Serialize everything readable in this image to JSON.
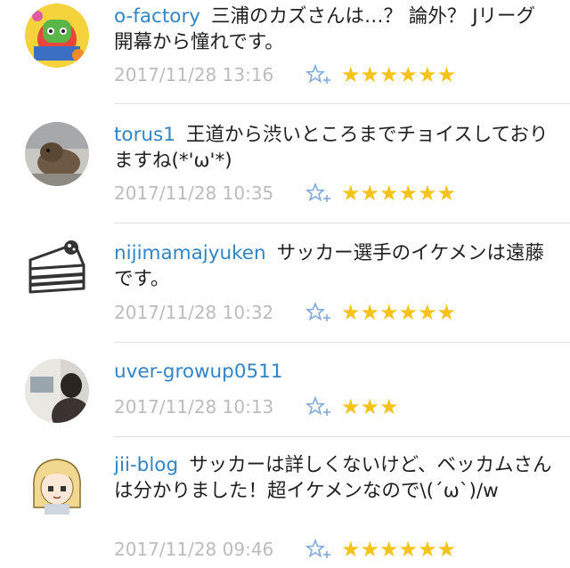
{
  "comments": [
    {
      "username": "o-factory",
      "text": "三浦のカズさんは…？ 論外？ Jリーグ開幕から憧れです。",
      "date": "2017/11/28 13:16",
      "stars": "★★★★★★",
      "star_count": 6,
      "avatar_icon": "cartoon-character-avatar-icon"
    },
    {
      "username": "torus1",
      "text": "王道から渋いところまでチョイスしておりますね(*'ω'*)",
      "date": "2017/11/28 10:35",
      "stars": "★★★★★★",
      "star_count": 6,
      "avatar_icon": "animal-photo-avatar-icon"
    },
    {
      "username": "nijimamajyuken",
      "text": "サッカー選手のイケメンは遠藤です。",
      "date": "2017/11/28 10:32",
      "stars": "★★★★★★",
      "star_count": 6,
      "avatar_icon": "cake-slice-avatar-icon"
    },
    {
      "username": "uver-growup0511",
      "text": "",
      "date": "2017/11/28 10:13",
      "stars": "★★★",
      "star_count": 3,
      "avatar_icon": "person-photo-avatar-icon"
    },
    {
      "username": "jii-blog",
      "text": "サッカーは詳しくないけど、ベッカムさんは分かりました！超イケメンなので\\(´ω`)/w",
      "date": "2017/11/28 09:46",
      "stars": "★★★★★★",
      "star_count": 6,
      "avatar_icon": "anime-girl-avatar-icon"
    }
  ],
  "colors": {
    "username": "#3384c4",
    "star": "#f7c21a",
    "date": "#bcbcbc",
    "add_star_icon": "#7fa8df"
  },
  "add_star_icon": "add-star-icon"
}
